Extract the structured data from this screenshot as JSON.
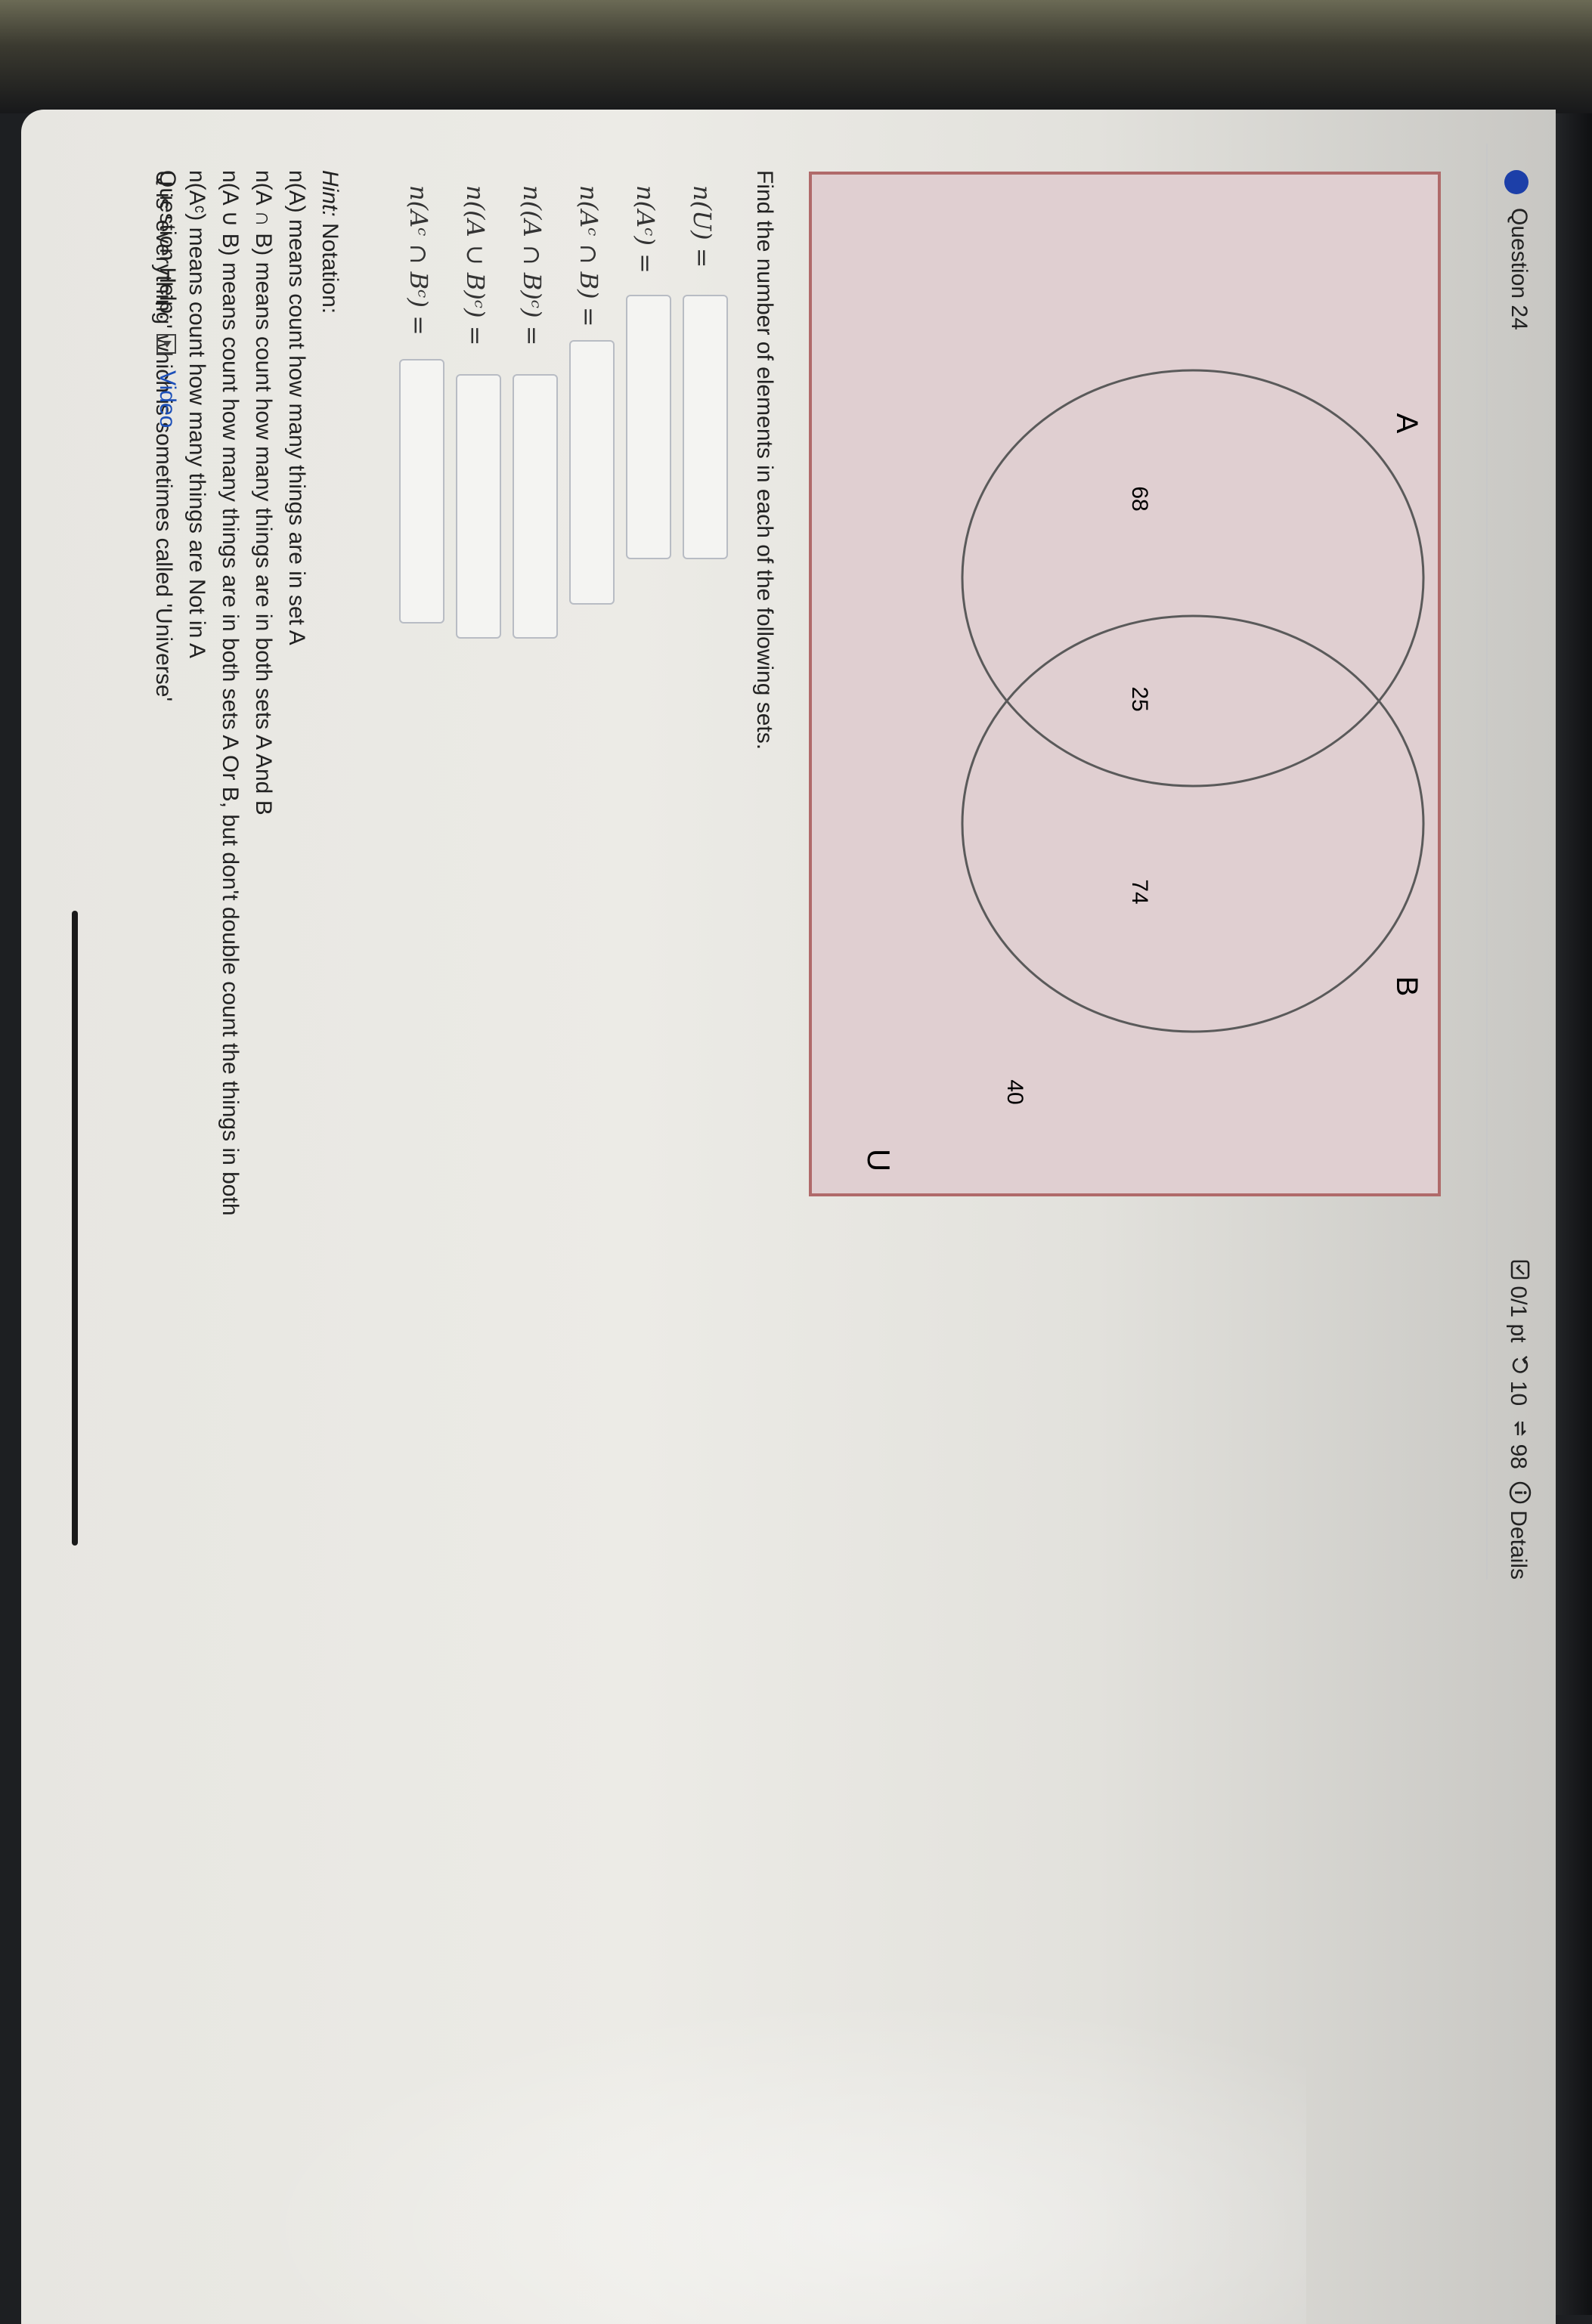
{
  "header": {
    "question_title": "Question 24",
    "score": "0/1 pt",
    "retries": "10",
    "submissions": "98",
    "details_label": "Details"
  },
  "venn": {
    "label_a": "A",
    "label_b": "B",
    "label_u": "U",
    "only_a": "68",
    "both": "25",
    "only_b": "74",
    "outside": "40",
    "colors": {
      "fill": "#e0cfd1",
      "border": "#b06a6a",
      "circle": "#5a5a5a"
    }
  },
  "prompt": "Find the number of elements in each of the following sets.",
  "questions": [
    {
      "label": "n(U) =",
      "value": ""
    },
    {
      "label": "n(Aᶜ) =",
      "value": ""
    },
    {
      "label": "n(Aᶜ ∩ B) =",
      "value": ""
    },
    {
      "label": "n((A ∩ B)ᶜ) =",
      "value": ""
    },
    {
      "label": "n((A ∪ B)ᶜ) =",
      "value": ""
    },
    {
      "label": "n(Aᶜ ∩ Bᶜ) =",
      "value": ""
    }
  ],
  "hint": {
    "title": "Hint:",
    "title_rest": " Notation:",
    "lines": [
      "n(A) means count how many things are in set A",
      "n(A ∩ B) means count how many things are in both sets A And B",
      "n(A ∪ B) means count how many things are in both sets A Or B, but don't double count the things in both",
      "n(Aᶜ) means count how many things are Not in A",
      "U is 'everything' which is sometimes called 'Universe'"
    ]
  },
  "help": {
    "label": "Question Help:",
    "video_label": "Video"
  }
}
